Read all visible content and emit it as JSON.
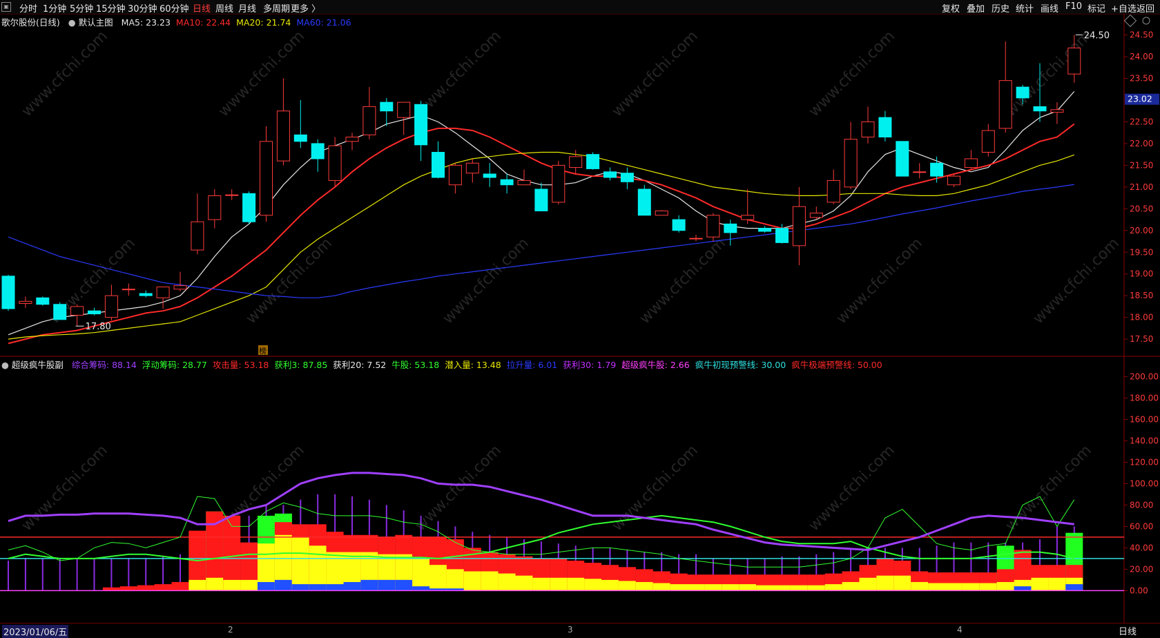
{
  "toolbar": {
    "left": [
      {
        "label": "分时",
        "active": false
      },
      {
        "label": "1分钟",
        "active": false
      },
      {
        "label": "5分钟",
        "active": false
      },
      {
        "label": "15分钟",
        "active": false
      },
      {
        "label": "30分钟",
        "active": false
      },
      {
        "label": "60分钟",
        "active": false
      },
      {
        "label": "日线",
        "active": true
      },
      {
        "label": "周线",
        "active": false
      },
      {
        "label": "月线",
        "active": false
      },
      {
        "label": "多周期",
        "active": false
      },
      {
        "label": "更多 〉",
        "active": false
      }
    ],
    "right": [
      "复权",
      "叠加",
      "历史",
      "统计",
      "画线",
      "F10",
      "标记",
      "+自选",
      "返回"
    ]
  },
  "main_header": {
    "stock": "歌尔股份(日线)",
    "template": "默认主图",
    "indicators": [
      {
        "label": "MA5: 23.23",
        "color": "#e8e8e8"
      },
      {
        "label": "MA10: 22.44",
        "color": "#ff2a2a"
      },
      {
        "label": "MA20: 21.74",
        "color": "#e8e800"
      },
      {
        "label": "MA60: 21.06",
        "color": "#2a3bff"
      }
    ]
  },
  "sub_header": {
    "name": "超级疯牛股副",
    "indicators": [
      {
        "label": "综合筹码: 88.14",
        "color": "#a040ff"
      },
      {
        "label": "浮动筹码: 28.77",
        "color": "#30ff30"
      },
      {
        "label": "攻击量: 53.18",
        "color": "#ff2a2a"
      },
      {
        "label": "获利3: 87.85",
        "color": "#30ff30"
      },
      {
        "label": "获利20: 7.52",
        "color": "#e8e8e8"
      },
      {
        "label": "牛股: 53.18",
        "color": "#30ff30"
      },
      {
        "label": "潜入量: 13.48",
        "color": "#e8e800"
      },
      {
        "label": "拉升量: 6.01",
        "color": "#2a3bff"
      },
      {
        "label": "获利30: 1.79",
        "color": "#c030ff"
      },
      {
        "label": "超级疯牛股: 2.66",
        "color": "#ff40ff"
      },
      {
        "label": "疯牛初现预警线: 30.00",
        "color": "#30e0e0"
      },
      {
        "label": "疯牛极端预警线: 50.00",
        "color": "#ff2a2a"
      }
    ]
  },
  "price_axis": {
    "ticks": [
      "24.50",
      "24.00",
      "23.50",
      "23.00",
      "22.50",
      "22.00",
      "21.50",
      "21.00",
      "20.50",
      "20.00",
      "19.50",
      "19.00",
      "18.50",
      "18.00",
      "17.50"
    ],
    "current_price": "23.02"
  },
  "sub_axis": {
    "ticks": [
      "200.00",
      "180.00",
      "160.00",
      "140.00",
      "120.00",
      "100.00",
      "80.00",
      "60.00",
      "40.00",
      "20.00",
      "0.00"
    ]
  },
  "annotations": {
    "high_label": "24.50",
    "low_label": "17.80",
    "badge": "榜"
  },
  "watermark": "www.cfchi.com",
  "bottom": {
    "date": "2023/01/06/五",
    "months": [
      "2",
      "3",
      "4"
    ],
    "period": "日线"
  },
  "chart_data": {
    "type": "candlestick",
    "title": "歌尔股份(日线)",
    "ylim": [
      17.2,
      24.7
    ],
    "candles": [
      {
        "o": 18.95,
        "h": 18.98,
        "l": 18.15,
        "c": 18.2
      },
      {
        "o": 18.32,
        "h": 18.48,
        "l": 18.22,
        "c": 18.37
      },
      {
        "o": 18.45,
        "h": 18.48,
        "l": 18.27,
        "c": 18.3
      },
      {
        "o": 18.3,
        "h": 18.35,
        "l": 17.95,
        "c": 17.95
      },
      {
        "o": 18.05,
        "h": 18.3,
        "l": 17.8,
        "c": 18.25
      },
      {
        "o": 18.15,
        "h": 18.22,
        "l": 18.05,
        "c": 18.08
      },
      {
        "o": 18.0,
        "h": 18.75,
        "l": 17.93,
        "c": 18.5
      },
      {
        "o": 18.65,
        "h": 18.78,
        "l": 18.5,
        "c": 18.65
      },
      {
        "o": 18.55,
        "h": 18.62,
        "l": 18.46,
        "c": 18.5
      },
      {
        "o": 18.45,
        "h": 18.7,
        "l": 18.2,
        "c": 18.7
      },
      {
        "o": 18.65,
        "h": 19.05,
        "l": 18.6,
        "c": 18.73
      },
      {
        "o": 19.55,
        "h": 20.85,
        "l": 19.45,
        "c": 20.2
      },
      {
        "o": 20.25,
        "h": 20.95,
        "l": 20.05,
        "c": 20.8
      },
      {
        "o": 20.82,
        "h": 20.95,
        "l": 20.7,
        "c": 20.82
      },
      {
        "o": 20.85,
        "h": 20.9,
        "l": 20.15,
        "c": 20.2
      },
      {
        "o": 20.35,
        "h": 22.4,
        "l": 20.2,
        "c": 22.05
      },
      {
        "o": 21.6,
        "h": 23.5,
        "l": 21.5,
        "c": 22.75
      },
      {
        "o": 22.2,
        "h": 23.0,
        "l": 21.9,
        "c": 22.05
      },
      {
        "o": 22.0,
        "h": 22.1,
        "l": 21.35,
        "c": 21.65
      },
      {
        "o": 21.15,
        "h": 22.15,
        "l": 21.0,
        "c": 21.95
      },
      {
        "o": 22.05,
        "h": 22.25,
        "l": 21.85,
        "c": 22.15
      },
      {
        "o": 22.2,
        "h": 23.3,
        "l": 22.1,
        "c": 22.85
      },
      {
        "o": 22.95,
        "h": 23.05,
        "l": 22.4,
        "c": 22.75
      },
      {
        "o": 22.6,
        "h": 22.95,
        "l": 22.2,
        "c": 22.95
      },
      {
        "o": 22.9,
        "h": 22.98,
        "l": 21.6,
        "c": 21.97
      },
      {
        "o": 21.8,
        "h": 22.05,
        "l": 21.2,
        "c": 21.22
      },
      {
        "o": 21.05,
        "h": 21.55,
        "l": 20.85,
        "c": 21.5
      },
      {
        "o": 21.32,
        "h": 21.65,
        "l": 21.1,
        "c": 21.55
      },
      {
        "o": 21.3,
        "h": 21.55,
        "l": 21.0,
        "c": 21.22
      },
      {
        "o": 21.17,
        "h": 21.3,
        "l": 20.85,
        "c": 21.05
      },
      {
        "o": 21.05,
        "h": 21.4,
        "l": 21.05,
        "c": 21.15
      },
      {
        "o": 20.95,
        "h": 21.1,
        "l": 20.45,
        "c": 20.45
      },
      {
        "o": 20.65,
        "h": 21.6,
        "l": 20.6,
        "c": 21.5
      },
      {
        "o": 21.45,
        "h": 21.85,
        "l": 21.3,
        "c": 21.7
      },
      {
        "o": 21.75,
        "h": 21.8,
        "l": 21.4,
        "c": 21.42
      },
      {
        "o": 21.35,
        "h": 21.45,
        "l": 21.15,
        "c": 21.22
      },
      {
        "o": 21.32,
        "h": 21.45,
        "l": 20.95,
        "c": 21.12
      },
      {
        "o": 20.95,
        "h": 21.05,
        "l": 20.35,
        "c": 20.35
      },
      {
        "o": 20.35,
        "h": 20.47,
        "l": 20.35,
        "c": 20.45
      },
      {
        "o": 20.25,
        "h": 20.35,
        "l": 19.95,
        "c": 20.0
      },
      {
        "o": 19.82,
        "h": 19.9,
        "l": 19.75,
        "c": 19.82
      },
      {
        "o": 19.85,
        "h": 20.4,
        "l": 19.75,
        "c": 20.35
      },
      {
        "o": 20.15,
        "h": 20.25,
        "l": 19.65,
        "c": 19.95
      },
      {
        "o": 20.25,
        "h": 20.95,
        "l": 20.15,
        "c": 20.35
      },
      {
        "o": 20.05,
        "h": 20.1,
        "l": 19.95,
        "c": 19.98
      },
      {
        "o": 20.05,
        "h": 20.15,
        "l": 19.7,
        "c": 19.72
      },
      {
        "o": 19.65,
        "h": 21.0,
        "l": 19.2,
        "c": 20.55
      },
      {
        "o": 20.3,
        "h": 20.55,
        "l": 20.25,
        "c": 20.4
      },
      {
        "o": 20.65,
        "h": 21.4,
        "l": 20.6,
        "c": 21.15
      },
      {
        "o": 21.0,
        "h": 22.5,
        "l": 20.95,
        "c": 22.1
      },
      {
        "o": 22.15,
        "h": 22.85,
        "l": 22.0,
        "c": 22.5
      },
      {
        "o": 22.6,
        "h": 22.75,
        "l": 22.05,
        "c": 22.15
      },
      {
        "o": 22.05,
        "h": 22.05,
        "l": 21.25,
        "c": 21.25
      },
      {
        "o": 21.35,
        "h": 21.55,
        "l": 21.2,
        "c": 21.35
      },
      {
        "o": 21.55,
        "h": 21.7,
        "l": 21.1,
        "c": 21.25
      },
      {
        "o": 21.05,
        "h": 21.3,
        "l": 21.0,
        "c": 21.25
      },
      {
        "o": 21.45,
        "h": 21.85,
        "l": 21.4,
        "c": 21.65
      },
      {
        "o": 21.8,
        "h": 22.45,
        "l": 21.7,
        "c": 22.3
      },
      {
        "o": 22.35,
        "h": 24.35,
        "l": 22.25,
        "c": 23.45
      },
      {
        "o": 23.3,
        "h": 23.35,
        "l": 22.9,
        "c": 23.05
      },
      {
        "o": 22.85,
        "h": 23.85,
        "l": 22.5,
        "c": 22.75
      },
      {
        "o": 22.72,
        "h": 22.95,
        "l": 22.45,
        "c": 22.78
      },
      {
        "o": 23.6,
        "h": 24.5,
        "l": 23.4,
        "c": 24.2
      }
    ],
    "ma_series": [
      {
        "name": "MA5",
        "color": "#e8e8e8",
        "values": [
          17.6,
          17.75,
          17.9,
          18.0,
          18.05,
          18.1,
          18.15,
          18.2,
          18.25,
          18.35,
          18.5,
          18.9,
          19.4,
          19.85,
          20.15,
          20.55,
          21.05,
          21.45,
          21.8,
          21.95,
          22.1,
          22.25,
          22.45,
          22.55,
          22.65,
          22.5,
          22.25,
          21.95,
          21.65,
          21.3,
          21.15,
          21.05,
          21.05,
          21.1,
          21.25,
          21.35,
          21.3,
          21.15,
          20.95,
          20.75,
          20.45,
          20.2,
          20.1,
          20.05,
          20.05,
          20.05,
          20.15,
          20.25,
          20.45,
          20.8,
          21.35,
          21.75,
          21.9,
          21.75,
          21.6,
          21.45,
          21.35,
          21.45,
          21.85,
          22.3,
          22.6,
          22.75,
          23.2
        ]
      },
      {
        "name": "MA10",
        "color": "#ff2a2a",
        "values": [
          17.4,
          17.5,
          17.6,
          17.65,
          17.7,
          17.8,
          17.9,
          18.0,
          18.1,
          18.15,
          18.25,
          18.45,
          18.7,
          18.95,
          19.25,
          19.55,
          19.95,
          20.35,
          20.7,
          21.0,
          21.35,
          21.65,
          21.9,
          22.1,
          22.25,
          22.35,
          22.35,
          22.3,
          22.15,
          21.95,
          21.75,
          21.55,
          21.4,
          21.3,
          21.25,
          21.25,
          21.2,
          21.15,
          21.05,
          20.9,
          20.75,
          20.55,
          20.4,
          20.25,
          20.15,
          20.05,
          20.05,
          20.15,
          20.3,
          20.45,
          20.65,
          20.85,
          21.0,
          21.1,
          21.2,
          21.3,
          21.4,
          21.5,
          21.65,
          21.85,
          22.05,
          22.15,
          22.45
        ]
      },
      {
        "name": "MA20",
        "color": "#e8e800",
        "values": [
          17.5,
          17.55,
          17.58,
          17.6,
          17.62,
          17.65,
          17.7,
          17.75,
          17.8,
          17.85,
          17.9,
          18.05,
          18.2,
          18.35,
          18.5,
          18.7,
          19.1,
          19.5,
          19.8,
          20.05,
          20.3,
          20.55,
          20.8,
          21.05,
          21.25,
          21.4,
          21.55,
          21.65,
          21.7,
          21.75,
          21.78,
          21.8,
          21.8,
          21.75,
          21.7,
          21.6,
          21.5,
          21.4,
          21.3,
          21.2,
          21.1,
          21.0,
          20.95,
          20.9,
          20.85,
          20.82,
          20.8,
          20.8,
          20.82,
          20.85,
          20.85,
          20.85,
          20.82,
          20.8,
          20.8,
          20.85,
          20.95,
          21.05,
          21.2,
          21.35,
          21.5,
          21.6,
          21.74
        ]
      },
      {
        "name": "MA60",
        "color": "#2a3bff",
        "values": [
          19.85,
          19.7,
          19.55,
          19.4,
          19.3,
          19.2,
          19.1,
          19.0,
          18.9,
          18.8,
          18.75,
          18.7,
          18.65,
          18.6,
          18.55,
          18.5,
          18.48,
          18.45,
          18.45,
          18.5,
          18.6,
          18.68,
          18.75,
          18.82,
          18.88,
          18.95,
          19.0,
          19.05,
          19.1,
          19.15,
          19.2,
          19.25,
          19.3,
          19.35,
          19.4,
          19.45,
          19.5,
          19.55,
          19.6,
          19.65,
          19.7,
          19.75,
          19.8,
          19.85,
          19.9,
          19.95,
          20.0,
          20.05,
          20.1,
          20.15,
          20.22,
          20.3,
          20.38,
          20.45,
          20.52,
          20.6,
          20.68,
          20.75,
          20.82,
          20.9,
          20.95,
          21.0,
          21.06
        ]
      }
    ],
    "sub_ylim": [
      -3,
      210
    ],
    "sub_lines": {
      "composite": [
        65,
        70,
        70,
        71,
        71,
        72,
        72,
        72,
        71,
        70,
        68,
        62,
        62,
        70,
        76,
        80,
        90,
        100,
        105,
        108,
        110,
        110,
        109,
        108,
        105,
        100,
        99,
        99,
        97,
        93,
        89,
        85,
        80,
        75,
        70,
        70,
        70,
        68,
        66,
        64,
        62,
        57,
        53,
        49,
        45,
        43,
        42,
        41,
        40,
        39,
        38,
        42,
        46,
        50,
        56,
        62,
        68,
        70,
        69,
        68,
        66,
        64,
        62
      ]
    },
    "threshold_lines": [
      {
        "name": "疯牛初现预警线",
        "value": 30,
        "color": "#30e0e0"
      },
      {
        "name": "疯牛极端预警线",
        "value": 50,
        "color": "#ff2a2a"
      }
    ]
  }
}
